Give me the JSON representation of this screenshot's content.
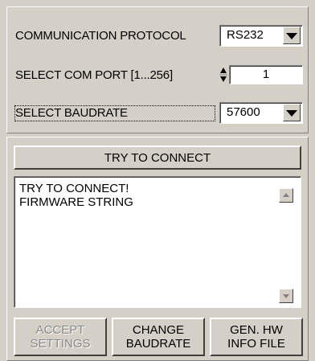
{
  "settings": {
    "protocol_label": "COMMUNICATION PROTOCOL",
    "protocol_value": "RS232",
    "com_port_label": "SELECT COM PORT [1...256]",
    "com_port_value": "1",
    "baudrate_label": "SELECT BAUDRATE",
    "baudrate_value": "57600"
  },
  "connect": {
    "try_connect_label": "TRY TO CONNECT",
    "log_text": "TRY TO CONNECT!\nFIRMWARE STRING"
  },
  "actions": {
    "accept_label": "ACCEPT\nSETTINGS",
    "change_baudrate_label": "CHANGE\nBAUDRATE",
    "gen_hw_label": "GEN. HW\nINFO FILE"
  },
  "icons": {
    "dropdown": "chevron-down-icon",
    "spinner": "spinner-arrows-icon",
    "scroll_up": "scroll-up-icon",
    "scroll_down": "scroll-down-icon"
  }
}
